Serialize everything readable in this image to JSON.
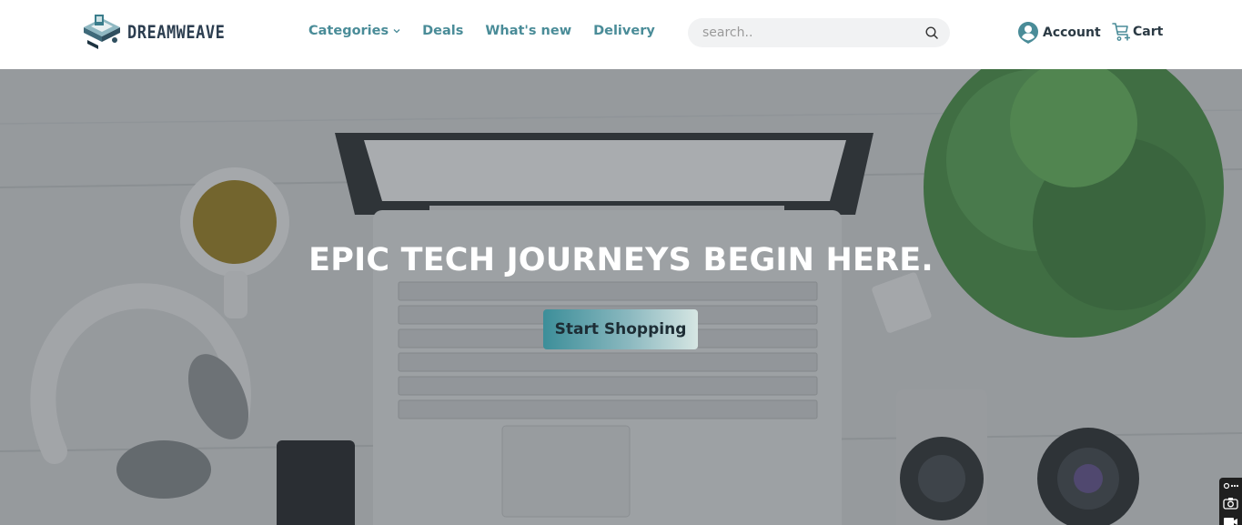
{
  "brand": {
    "name": "DREAMWEAVE"
  },
  "nav": {
    "items": [
      {
        "label": "Categories",
        "has_dropdown": true
      },
      {
        "label": "Deals"
      },
      {
        "label": "What's new"
      },
      {
        "label": "Delivery"
      }
    ]
  },
  "search": {
    "placeholder": "search..",
    "value": ""
  },
  "header_actions": {
    "account_label": "Account",
    "cart_label": "Cart"
  },
  "hero": {
    "title": "EPIC TECH JOURNEYS BEGIN HERE.",
    "cta_label": "Start Shopping"
  },
  "colors": {
    "accent": "#4a8c98",
    "text_dark": "#2b3a44",
    "hero_overlay": "#5a6268"
  }
}
